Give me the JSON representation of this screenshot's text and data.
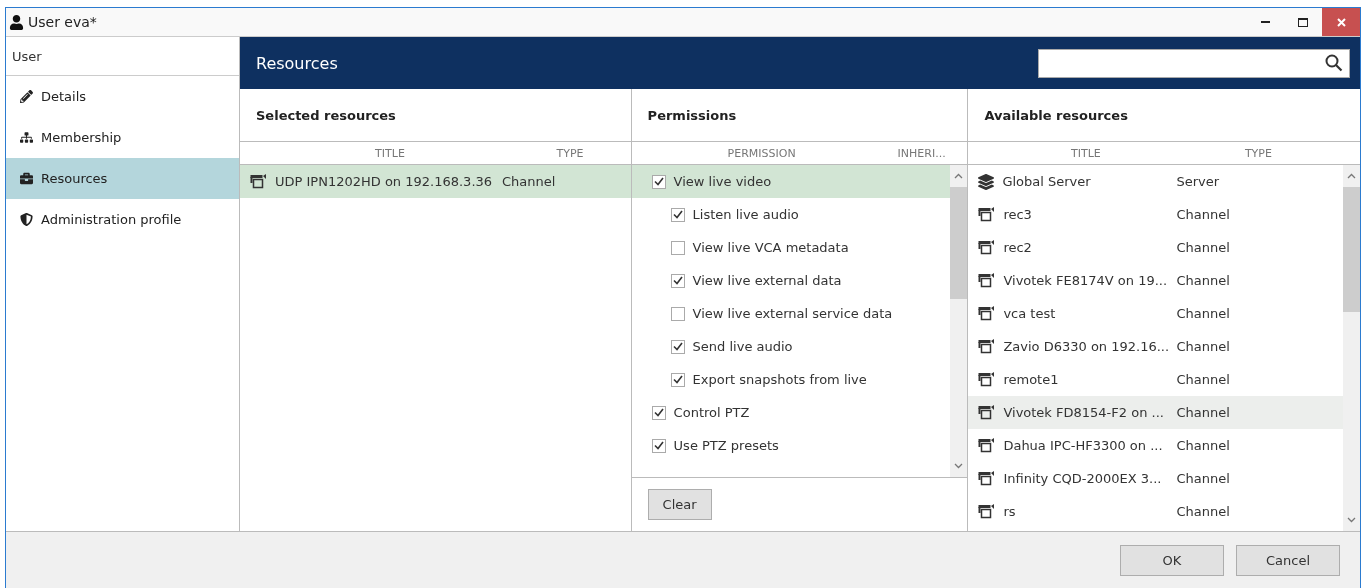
{
  "window": {
    "title": "User eva*"
  },
  "sidebar": {
    "heading": "User",
    "items": [
      {
        "label": "Details",
        "kind": "pencil",
        "selected": false
      },
      {
        "label": "Membership",
        "kind": "hierarchy",
        "selected": false
      },
      {
        "label": "Resources",
        "kind": "briefcase",
        "selected": true
      },
      {
        "label": "Administration profile",
        "kind": "shield",
        "selected": false
      }
    ]
  },
  "header": {
    "title": "Resources"
  },
  "selected_resources": {
    "title": "Selected resources",
    "columns": [
      "TITLE",
      "TYPE"
    ],
    "rows": [
      {
        "title": "UDP IPN1202HD on 192.168.3.36",
        "type": "Channel",
        "kind": "channel",
        "selected": true
      }
    ]
  },
  "permissions": {
    "title": "Permissions",
    "columns": [
      "PERMISSION",
      "INHERI..."
    ],
    "items": [
      {
        "label": "View live video",
        "checked": true,
        "selected": true,
        "children": [
          {
            "label": "Listen live audio",
            "checked": true,
            "selected": false
          },
          {
            "label": "View live VCA metadata",
            "checked": false,
            "selected": false
          },
          {
            "label": "View live external data",
            "checked": true,
            "selected": false
          },
          {
            "label": "View live external service data",
            "checked": false,
            "selected": false
          },
          {
            "label": "Send live audio",
            "checked": true,
            "selected": false
          },
          {
            "label": "Export snapshots from live",
            "checked": true,
            "selected": false
          }
        ]
      },
      {
        "label": "Control PTZ",
        "checked": true,
        "selected": false
      },
      {
        "label": "Use PTZ presets",
        "checked": true,
        "selected": false
      }
    ],
    "clear_button": "Clear"
  },
  "available_resources": {
    "title": "Available resources",
    "columns": [
      "TITLE",
      "TYPE"
    ],
    "rows": [
      {
        "title": "Global Server",
        "type": "Server",
        "kind": "server",
        "selected": false
      },
      {
        "title": "rec3",
        "type": "Channel",
        "kind": "channel",
        "selected": false
      },
      {
        "title": "rec2",
        "type": "Channel",
        "kind": "channel",
        "selected": false
      },
      {
        "title": "Vivotek FE8174V on 19...",
        "type": "Channel",
        "kind": "channel",
        "selected": false
      },
      {
        "title": "vca test",
        "type": "Channel",
        "kind": "channel",
        "selected": false
      },
      {
        "title": "Zavio D6330 on 192.16...",
        "type": "Channel",
        "kind": "channel",
        "selected": false
      },
      {
        "title": "remote1",
        "type": "Channel",
        "kind": "channel",
        "selected": false
      },
      {
        "title": "Vivotek FD8154-F2 on ...",
        "type": "Channel",
        "kind": "channel",
        "selected": true
      },
      {
        "title": "Dahua IPC-HF3300 on ...",
        "type": "Channel",
        "kind": "channel",
        "selected": false
      },
      {
        "title": "Infinity CQD-2000EX 3...",
        "type": "Channel",
        "kind": "channel",
        "selected": false
      },
      {
        "title": "rs",
        "type": "Channel",
        "kind": "channel",
        "selected": false
      }
    ]
  },
  "buttons": [
    "OK",
    "Cancel"
  ]
}
